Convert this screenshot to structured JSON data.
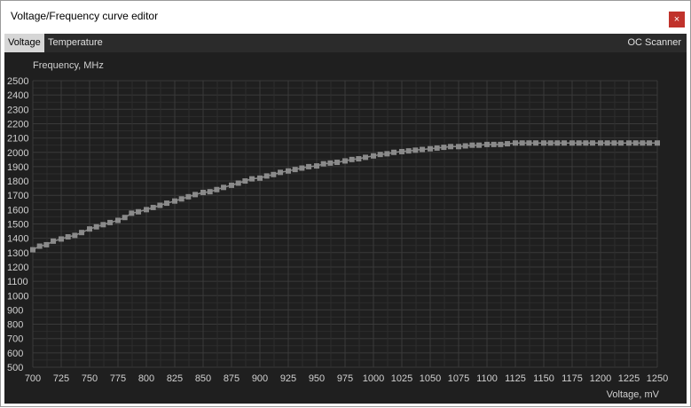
{
  "window": {
    "title": "Voltage/Frequency curve editor",
    "close_label": "×"
  },
  "tabs": [
    {
      "label": "Voltage",
      "active": true
    },
    {
      "label": "Temperature",
      "active": false
    }
  ],
  "oc_scanner_label": "OC Scanner",
  "colors": {
    "background": "#1f1f1f",
    "grid": "#3a3a3a",
    "curve": "#8a8a8a",
    "text": "#d0d0d0",
    "close": "#c0322b"
  },
  "chart_data": {
    "type": "line",
    "ylabel": "Frequency, MHz",
    "xlabel": "Voltage, mV",
    "xlim": [
      700,
      1250
    ],
    "ylim": [
      500,
      2500
    ],
    "grid": true,
    "x_ticks": [
      "700",
      "725",
      "750",
      "775",
      "800",
      "825",
      "850",
      "875",
      "900",
      "925",
      "950",
      "975",
      "1000",
      "1025",
      "1050",
      "1075",
      "1100",
      "1125",
      "1150",
      "1175",
      "1200",
      "1225",
      "1250"
    ],
    "y_ticks": [
      "2500",
      "2400",
      "2300",
      "2200",
      "2100",
      "2000",
      "1900",
      "1800",
      "1700",
      "1600",
      "1500",
      "1400",
      "1300",
      "1200",
      "1100",
      "1000",
      "900",
      "800",
      "700",
      "600",
      "500"
    ],
    "series": [
      {
        "x": [
          700,
          706,
          712,
          718,
          725,
          731,
          737,
          743,
          750,
          756,
          762,
          768,
          775,
          781,
          787,
          793,
          800,
          806,
          812,
          818,
          825,
          831,
          837,
          843,
          850,
          856,
          862,
          868,
          875,
          881,
          887,
          893,
          900,
          906,
          912,
          918,
          925,
          931,
          937,
          943,
          950,
          956,
          962,
          968,
          975,
          981,
          987,
          993,
          1000,
          1006,
          1012,
          1018,
          1025,
          1031,
          1037,
          1043,
          1050,
          1056,
          1062,
          1068,
          1075,
          1081,
          1087,
          1093,
          1100,
          1106,
          1112,
          1118,
          1125,
          1131,
          1137,
          1143,
          1150,
          1156,
          1162,
          1168,
          1175,
          1181,
          1187,
          1193,
          1200,
          1206,
          1212,
          1218,
          1225,
          1231,
          1237,
          1243,
          1250
        ],
        "y": [
          1320,
          1345,
          1355,
          1380,
          1395,
          1410,
          1420,
          1440,
          1465,
          1480,
          1495,
          1510,
          1525,
          1545,
          1575,
          1585,
          1600,
          1615,
          1630,
          1645,
          1660,
          1675,
          1690,
          1705,
          1720,
          1725,
          1740,
          1755,
          1770,
          1785,
          1800,
          1815,
          1820,
          1835,
          1845,
          1860,
          1870,
          1880,
          1890,
          1900,
          1905,
          1920,
          1925,
          1930,
          1940,
          1950,
          1955,
          1965,
          1975,
          1985,
          1990,
          2000,
          2005,
          2010,
          2015,
          2020,
          2025,
          2030,
          2035,
          2040,
          2040,
          2045,
          2050,
          2050,
          2055,
          2055,
          2055,
          2060,
          2065,
          2065,
          2065,
          2065,
          2065,
          2065,
          2065,
          2065,
          2065,
          2065,
          2065,
          2065,
          2065,
          2065,
          2065,
          2065,
          2065,
          2065,
          2065,
          2065,
          2065
        ]
      }
    ]
  }
}
